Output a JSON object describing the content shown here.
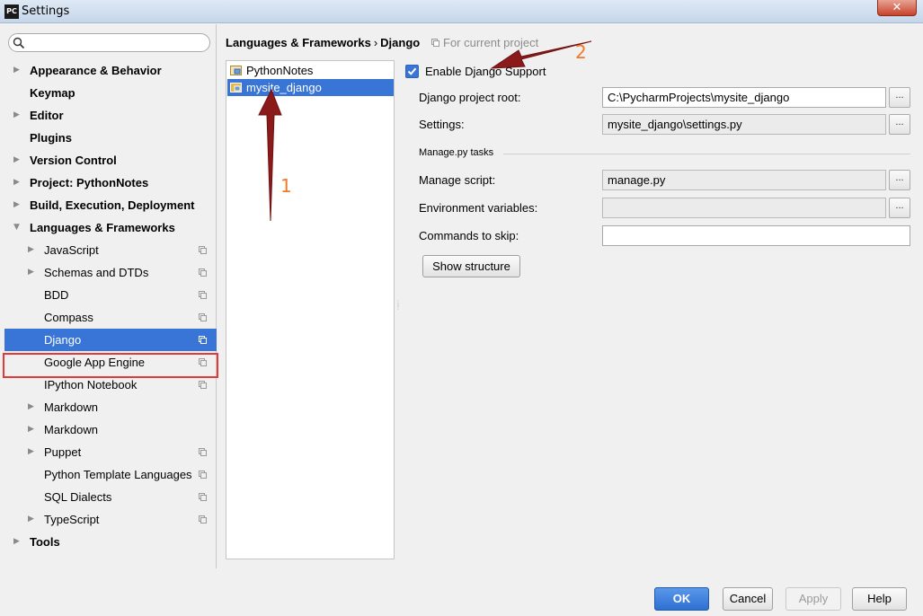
{
  "window": {
    "app_icon_text": "PC",
    "title": "Settings",
    "close_glyph": "✕"
  },
  "sidebar": {
    "search": {
      "value": "",
      "placeholder": ""
    },
    "items": [
      {
        "label": "Appearance & Behavior",
        "bold": true,
        "expandable": true,
        "expanded": false
      },
      {
        "label": "Keymap",
        "bold": true,
        "expandable": false
      },
      {
        "label": "Editor",
        "bold": true,
        "expandable": true,
        "expanded": false
      },
      {
        "label": "Plugins",
        "bold": true,
        "expandable": false
      },
      {
        "label": "Version Control",
        "bold": true,
        "expandable": true,
        "expanded": false
      },
      {
        "label": "Project: PythonNotes",
        "bold": true,
        "expandable": true,
        "expanded": false
      },
      {
        "label": "Build, Execution, Deployment",
        "bold": true,
        "expandable": true,
        "expanded": false
      },
      {
        "label": "Languages & Frameworks",
        "bold": true,
        "expandable": true,
        "expanded": true
      },
      {
        "label": "JavaScript",
        "child": true,
        "expandable": true,
        "project_icon": true
      },
      {
        "label": "Schemas and DTDs",
        "child": true,
        "expandable": true,
        "project_icon": true
      },
      {
        "label": "BDD",
        "child": true,
        "project_icon": true
      },
      {
        "label": "Compass",
        "child": true,
        "project_icon": true
      },
      {
        "label": "Django",
        "child": true,
        "project_icon": true,
        "selected": true
      },
      {
        "label": "Google App Engine",
        "child": true,
        "project_icon": true
      },
      {
        "label": "IPython Notebook",
        "child": true,
        "project_icon": true
      },
      {
        "label": "Markdown",
        "child": true,
        "expandable": true
      },
      {
        "label": "Markdown",
        "child": true,
        "expandable": true
      },
      {
        "label": "Puppet",
        "child": true,
        "expandable": true,
        "project_icon": true
      },
      {
        "label": "Python Template Languages",
        "child": true,
        "project_icon": true
      },
      {
        "label": "SQL Dialects",
        "child": true,
        "project_icon": true
      },
      {
        "label": "TypeScript",
        "child": true,
        "expandable": true,
        "project_icon": true
      },
      {
        "label": "Tools",
        "bold": true,
        "expandable": true,
        "expanded": false
      }
    ]
  },
  "header": {
    "breadcrumb_parent": "Languages & Frameworks",
    "breadcrumb_separator": "›",
    "breadcrumb_current": "Django",
    "scope": "For current project"
  },
  "projects": [
    {
      "label": "PythonNotes",
      "selected": false
    },
    {
      "label": "mysite_django",
      "selected": true
    }
  ],
  "django": {
    "enable_label": "Enable Django Support",
    "enabled": true,
    "project_root_label": "Django project root:",
    "project_root_value": "C:\\PycharmProjects\\mysite_django",
    "settings_label": "Settings:",
    "settings_value": "mysite_django\\settings.py",
    "manage_section": "Manage.py tasks",
    "manage_script_label": "Manage script:",
    "manage_script_value": "manage.py",
    "env_vars_label": "Environment variables:",
    "env_vars_value": "",
    "commands_skip_label": "Commands to skip:",
    "commands_skip_value": "",
    "browse_label": "...",
    "show_structure": "Show structure"
  },
  "buttons": {
    "ok": "OK",
    "cancel": "Cancel",
    "apply": "Apply",
    "help": "Help"
  },
  "annotations": {
    "marker_1": "1",
    "marker_2": "2",
    "color": "#8b1a1a"
  }
}
